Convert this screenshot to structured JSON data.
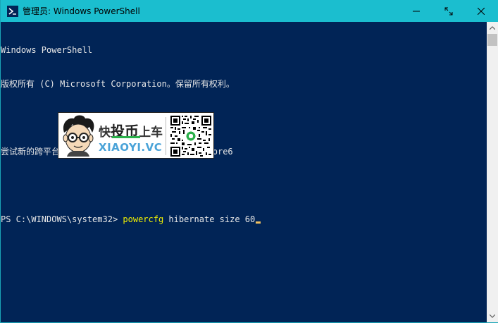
{
  "window": {
    "title": "管理员: Windows PowerShell",
    "accent_color": "#1bbecf",
    "console_bg": "#012456",
    "icons": {
      "app": "powershell-icon",
      "minimize": "minimize-icon",
      "maximize": "maximize-icon",
      "close": "close-icon"
    }
  },
  "console": {
    "line1": "Windows PowerShell",
    "line2": "版权所有 (C) Microsoft Corporation。保留所有权利。",
    "line3": "尝试新的跨平台 PowerShell https://aka.ms/pscore6",
    "prompt": "PS C:\\WINDOWS\\system32> ",
    "command": "powercfg",
    "args": " hibernate size 60"
  },
  "watermark": {
    "text_line1_a": "快",
    "text_line1_b": "投币",
    "text_line1_c": "上车",
    "text_line2": "XIAOYI.VC"
  }
}
